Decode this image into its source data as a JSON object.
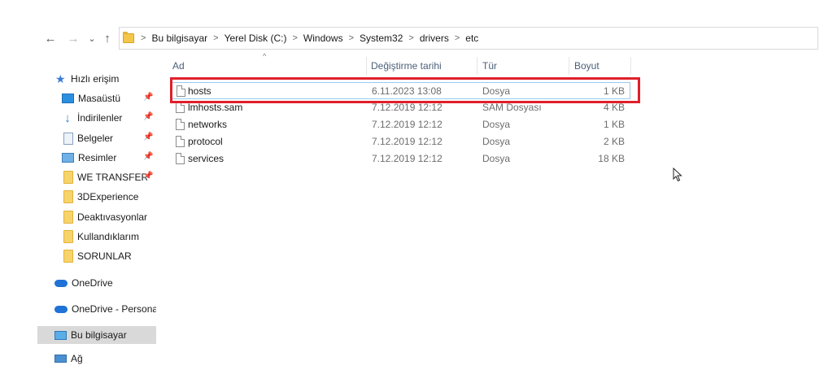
{
  "nav": {
    "back": "←",
    "forward": "→",
    "recent": "⌄",
    "up": "↑"
  },
  "breadcrumb": [
    {
      "label": "Bu bilgisayar"
    },
    {
      "label": "Yerel Disk (C:)"
    },
    {
      "label": "Windows"
    },
    {
      "label": "System32"
    },
    {
      "label": "drivers"
    },
    {
      "label": "etc"
    }
  ],
  "sidebar": {
    "items": [
      {
        "label": "Hızlı erişim",
        "icon": "star-icon"
      },
      {
        "label": "Masaüstü",
        "icon": "desktop-icon",
        "pinned": true
      },
      {
        "label": "İndirilenler",
        "icon": "download-icon",
        "pinned": true
      },
      {
        "label": "Belgeler",
        "icon": "documents-icon",
        "pinned": true
      },
      {
        "label": "Resimler",
        "icon": "pictures-icon",
        "pinned": true
      },
      {
        "label": "WE TRANSFER KL",
        "icon": "folder-icon",
        "pinned": true
      },
      {
        "label": "3DExperience",
        "icon": "folder-icon"
      },
      {
        "label": "Deaktıvasyonlar",
        "icon": "folder-icon"
      },
      {
        "label": "Kullandıklarım",
        "icon": "folder-icon"
      },
      {
        "label": "SORUNLAR",
        "icon": "folder-icon"
      },
      {
        "label": "OneDrive",
        "icon": "cloud-icon"
      },
      {
        "label": "OneDrive - Personal",
        "icon": "cloud-icon"
      },
      {
        "label": "Bu bilgisayar",
        "icon": "computer-icon"
      },
      {
        "label": "Ağ",
        "icon": "network-icon"
      }
    ]
  },
  "columns": {
    "name": "Ad",
    "modified": "Değiştirme tarihi",
    "type": "Tür",
    "size": "Boyut"
  },
  "files": [
    {
      "name": "hosts",
      "modified": "6.11.2023 13:08",
      "type": "Dosya",
      "size": "1 KB"
    },
    {
      "name": "lmhosts.sam",
      "modified": "7.12.2019 12:12",
      "type": "SAM Dosyası",
      "size": "4 KB"
    },
    {
      "name": "networks",
      "modified": "7.12.2019 12:12",
      "type": "Dosya",
      "size": "1 KB"
    },
    {
      "name": "protocol",
      "modified": "7.12.2019 12:12",
      "type": "Dosya",
      "size": "2 KB"
    },
    {
      "name": "services",
      "modified": "7.12.2019 12:12",
      "type": "Dosya",
      "size": "18 KB"
    }
  ],
  "colors": {
    "highlight": "#e0202a",
    "selection_border": "#99c9ef",
    "sidebar_selected": "#d9d9d9"
  }
}
